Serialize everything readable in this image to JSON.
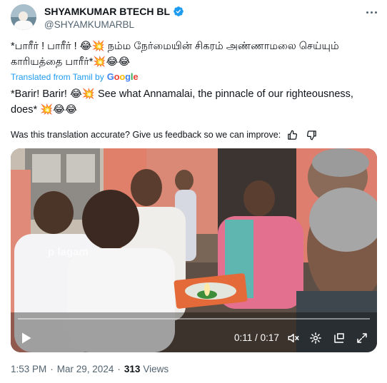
{
  "author": {
    "display_name": "SHYAMKUMAR BTECH BL",
    "handle": "@SHYAMKUMARBL"
  },
  "post": {
    "original_text": "*பாரீர் ! பாரீர் ! 😂💥 நம்ம நேர்மையின் சிகரம் அண்ணாமலை செய்யும் காரியத்தை பாரீர்*💥😂😂",
    "translated_label": "Translated from Tamil by",
    "translator": "Google",
    "translated_text": "*Barir! Barir! 😂💥 See what Annamalai, the pinnacle of our righteousness, does* 💥😂😂",
    "feedback_prompt": "Was this translation accurate? Give us feedback so we can improve:"
  },
  "video": {
    "watermark": "p         lagam",
    "current_time": "0:11",
    "duration": "0:17",
    "time_separator": "/",
    "progress": 0.0
  },
  "footer": {
    "time": "1:53 PM",
    "date": "Mar 29, 2024",
    "views_count": "313",
    "views_label": "Views"
  },
  "colors": {
    "accent": "#1d9bf0",
    "secondary_text": "#536471"
  },
  "icons": [
    "verified-badge-icon",
    "more-options-icon",
    "thumbs-up-icon",
    "thumbs-down-icon",
    "play-icon",
    "volume-muted-icon",
    "settings-icon",
    "pip-icon",
    "fullscreen-icon"
  ]
}
